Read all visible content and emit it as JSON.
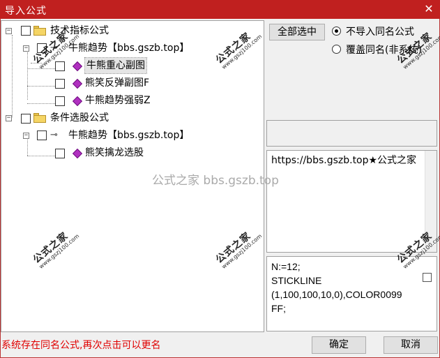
{
  "window": {
    "title": "导入公式",
    "close_glyph": "✕"
  },
  "tree": {
    "root1": {
      "label": "技术指标公式",
      "child": {
        "label": "牛熊趋势【bbs.gszb.top】",
        "items": [
          "牛熊重心副图",
          "熊笑反弹副图F",
          "牛熊趋势强弱Z"
        ]
      }
    },
    "root2": {
      "label": "条件选股公式",
      "child": {
        "label": "牛熊趋势【bbs.gszb.top】",
        "items": [
          "熊笑擒龙选股"
        ]
      }
    }
  },
  "controls": {
    "select_all": "全部选中",
    "radio_no_import": "不导入同名公式",
    "radio_overwrite": "覆盖同名(非系统)"
  },
  "description": "https://bbs.gszb.top★公式之家",
  "formula": "N:=12;\nSTICKLINE\n(1,100,100,10,0),COLOR0099\nFF;",
  "status": "系统存在同名公式,再次点击可以更名",
  "buttons": {
    "ok": "确定",
    "cancel": "取消"
  },
  "watermark": {
    "brand": "公式之家",
    "site": "www.gszj100.com",
    "center": "公式之家 bbs.gszb.top"
  },
  "colors": {
    "titlebar": "#c0201f",
    "status_text": "#e00000",
    "selected_row": "#e5e5e5"
  }
}
